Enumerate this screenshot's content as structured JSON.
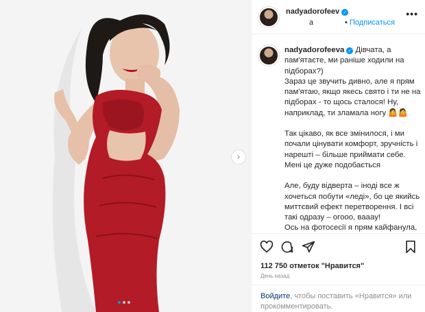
{
  "post": {
    "username": "nadyadorofeev",
    "username_suffix": "a",
    "follow_label": "Подписаться",
    "more_label": "•••",
    "caption_username": "nadyadorofeeva",
    "caption_lines": [
      "Дівчата, а пам'ятаєте, ми раніше ходили на підборах?)",
      "Зараз це звучить дивно, але я прям пам'ятаю, якщо якесь свято і ти не на підборах - то щось сталося! Ну, наприклад, ти зламала ногу 🤷🤷",
      "",
      "Так цікаво, як все змінилося, і ми почали цінувати комфорт, зручність і нарешті – більше приймати себе. Мені це дуже подобається",
      "",
      "Але, буду відверта – іноді все ж хочеться побути «леді», бо це якийсь миттєвий ефект перетворення. І всі такі одразу – огооо, вааау!",
      "Ось на фотосесії я прям кайфанула, а що більше кайфанула, коли після"
    ],
    "likes_text": "112 750 отметок \"Нравится\"",
    "time_text": "День назад",
    "comment_prompt": {
      "link": "Войдите",
      "rest": ", чтобы поставить «Нравится» или прокомментировать."
    }
  },
  "carousel": {
    "next_arrow": "›",
    "slide_count": 3,
    "active_slide": 1
  },
  "icons": [
    "heart-icon",
    "comment-icon",
    "share-icon",
    "bookmark-icon",
    "verified-icon",
    "chevron-right-icon"
  ],
  "colors": {
    "accent": "#0095f6",
    "dress": "#b31b26",
    "background": "#f3f3f3"
  }
}
